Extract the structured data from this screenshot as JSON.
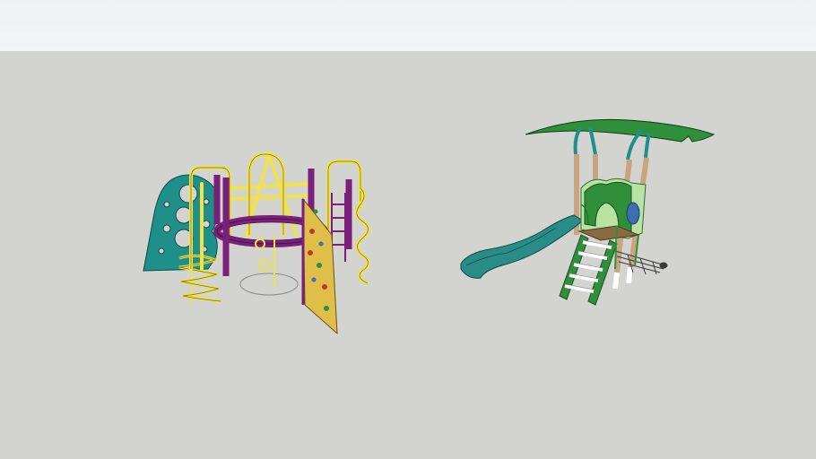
{
  "scene": {
    "colors": {
      "sky": "#f2f3f4",
      "ground": "#d3d3d0",
      "teal": "#1f8f8a",
      "yellow": "#f0e24a",
      "purple": "#7a1f7a",
      "wall": "#e0be4a",
      "hold": "#c0392b",
      "green": "#2f8f3a",
      "light_green": "#b9e3a3",
      "slide": "#2a8c86",
      "post": "#c8a482"
    }
  }
}
